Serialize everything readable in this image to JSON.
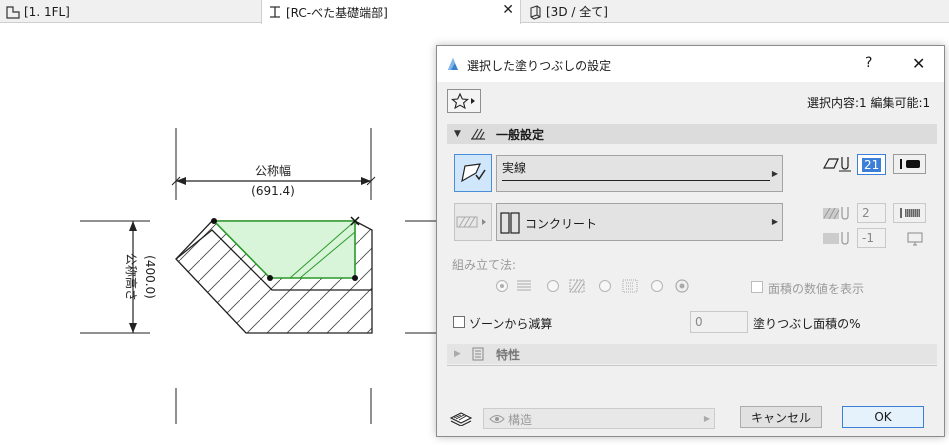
{
  "tabs": [
    {
      "label": "[1. 1FL]",
      "icon": "floor-plan-icon"
    },
    {
      "label": "[RC-べた基礎端部]",
      "icon": "section-detail-icon",
      "close": "✕"
    },
    {
      "label": "[3D / 全て]",
      "icon": "3d-view-icon"
    }
  ],
  "drawing": {
    "width_label": "公称幅",
    "width_value": "(691.4)",
    "height_label": "公称高さ",
    "height_value": "(400.0)"
  },
  "dialog": {
    "title": "選択した塗りつぶしの設定",
    "help": "?",
    "close": "✕",
    "selection_info": "選択内容:1 編集可能:1",
    "general_section": "一般設定",
    "line_type": "実線",
    "pen_number": "21",
    "fill_type": "コンクリート",
    "fg_pen": "2",
    "bg_pen": "-1",
    "construction_label": "組み立て法:",
    "show_area_label": "面積の数値を表示",
    "subtract_zone_label": "ゾーンから減算",
    "percent_value": "0",
    "percent_label": "塗りつぶし面積の%",
    "properties_section": "特性",
    "layer_name": "構造",
    "cancel": "キャンセル",
    "ok": "OK"
  },
  "colors": {
    "accent": "#3c7fd8",
    "fill_green": "#d9f5d9",
    "line_green": "#2a9a2a"
  }
}
